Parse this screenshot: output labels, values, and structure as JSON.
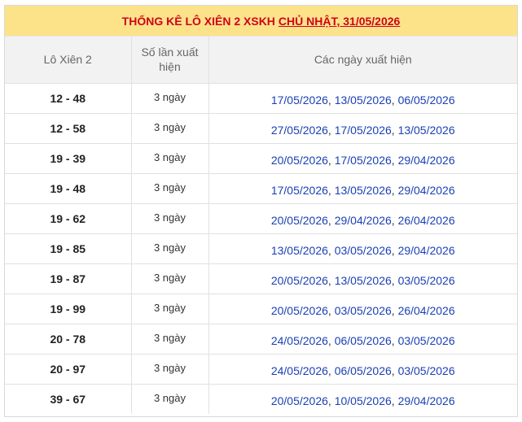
{
  "title": {
    "prefix": "THỐNG KÊ LÔ XIÊN 2 XSKH",
    "link": "CHỦ NHẬT, 31/05/2026"
  },
  "headers": {
    "col1": "Lô Xiên 2",
    "col2": "Số lần xuất hiện",
    "col3": "Các ngày xuất hiện"
  },
  "rows": [
    {
      "pair": "12 - 48",
      "count": "3 ngày",
      "dates": [
        "17/05/2026",
        "13/05/2026",
        "06/05/2026"
      ]
    },
    {
      "pair": "12 - 58",
      "count": "3 ngày",
      "dates": [
        "27/05/2026",
        "17/05/2026",
        "13/05/2026"
      ]
    },
    {
      "pair": "19 - 39",
      "count": "3 ngày",
      "dates": [
        "20/05/2026",
        "17/05/2026",
        "29/04/2026"
      ]
    },
    {
      "pair": "19 - 48",
      "count": "3 ngày",
      "dates": [
        "17/05/2026",
        "13/05/2026",
        "29/04/2026"
      ]
    },
    {
      "pair": "19 - 62",
      "count": "3 ngày",
      "dates": [
        "20/05/2026",
        "29/04/2026",
        "26/04/2026"
      ]
    },
    {
      "pair": "19 - 85",
      "count": "3 ngày",
      "dates": [
        "13/05/2026",
        "03/05/2026",
        "29/04/2026"
      ]
    },
    {
      "pair": "19 - 87",
      "count": "3 ngày",
      "dates": [
        "20/05/2026",
        "13/05/2026",
        "03/05/2026"
      ]
    },
    {
      "pair": "19 - 99",
      "count": "3 ngày",
      "dates": [
        "20/05/2026",
        "03/05/2026",
        "26/04/2026"
      ]
    },
    {
      "pair": "20 - 78",
      "count": "3 ngày",
      "dates": [
        "24/05/2026",
        "06/05/2026",
        "03/05/2026"
      ]
    },
    {
      "pair": "20 - 97",
      "count": "3 ngày",
      "dates": [
        "24/05/2026",
        "06/05/2026",
        "03/05/2026"
      ]
    },
    {
      "pair": "39 - 67",
      "count": "3 ngày",
      "dates": [
        "20/05/2026",
        "10/05/2026",
        "29/04/2026"
      ]
    }
  ]
}
